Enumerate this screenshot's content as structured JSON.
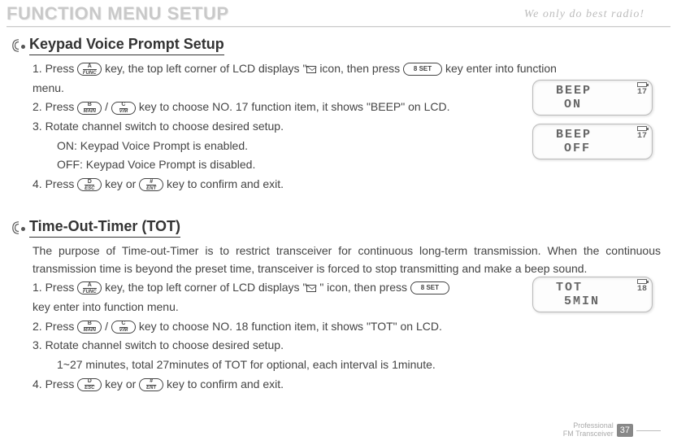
{
  "page_title": "FUNCTION MENU SETUP",
  "tagline": "We only do best radio!",
  "section1": {
    "title": "Keypad Voice Prompt Setup",
    "step1a": "1. Press ",
    "step1b": " key, the top left corner of LCD displays \"",
    "step1c": "icon, then press ",
    "step1d": " key enter into function",
    "step1e": " menu.",
    "step2a": "2. Press ",
    "step2b": "/",
    "step2c": " key to choose NO. 17 function item, it shows \"BEEP\" on LCD.",
    "step3": "3. Rotate channel switch to choose desired setup.",
    "step3on": "ON: Keypad Voice Prompt  is enabled.",
    "step3off": "OFF: Keypad Voice Prompt is disabled.",
    "step4a": "4. Press ",
    "step4b": " key or ",
    "step4c": " key to confirm and exit."
  },
  "section2": {
    "title": "Time-Out-Timer (TOT)",
    "intro": "The purpose of Time-out-Timer is to restrict transceiver for continuous long-term transmission. When the continuous transmission time is beyond the preset time, transceiver is forced to stop transmitting and make a beep sound.",
    "step1a": "1. Press ",
    "step1b": " key, the top left corner of LCD displays \"",
    "step1c": "\" icon, then press ",
    "step1d": "key enter into function menu.",
    "step2a": "2. Press ",
    "step2b": "/",
    "step2c": " key to choose NO. 18 function item, it shows \"TOT\" on LCD.",
    "step3": "3. Rotate channel switch to choose desired setup.",
    "step3a": "1~27 minutes, total 27minutes of TOT for optional, each interval is 1minute.",
    "step4a": "4. Press ",
    "step4b": " key or ",
    "step4c": " key to confirm and exit."
  },
  "keys": {
    "a_top": "A",
    "a_bot": "FUNC",
    "b_top": "B",
    "b_bot": "MAIN",
    "c_top": "C",
    "c_bot": "V/M",
    "d_top": "D",
    "d_bot": "ESC",
    "hash_top": "#",
    "hash_bot": "ENT",
    "eight": "8 SET"
  },
  "lcd": {
    "beep_on_1": "BEEP",
    "beep_on_2": "ON",
    "beep_on_n": "17",
    "beep_off_1": "BEEP",
    "beep_off_2": "OFF",
    "beep_off_n": "17",
    "tot_1": "TOT",
    "tot_2": "5MIN",
    "tot_n": "18"
  },
  "footer": {
    "line1": "Professional",
    "line2": "FM Transceiver",
    "page": "37"
  }
}
